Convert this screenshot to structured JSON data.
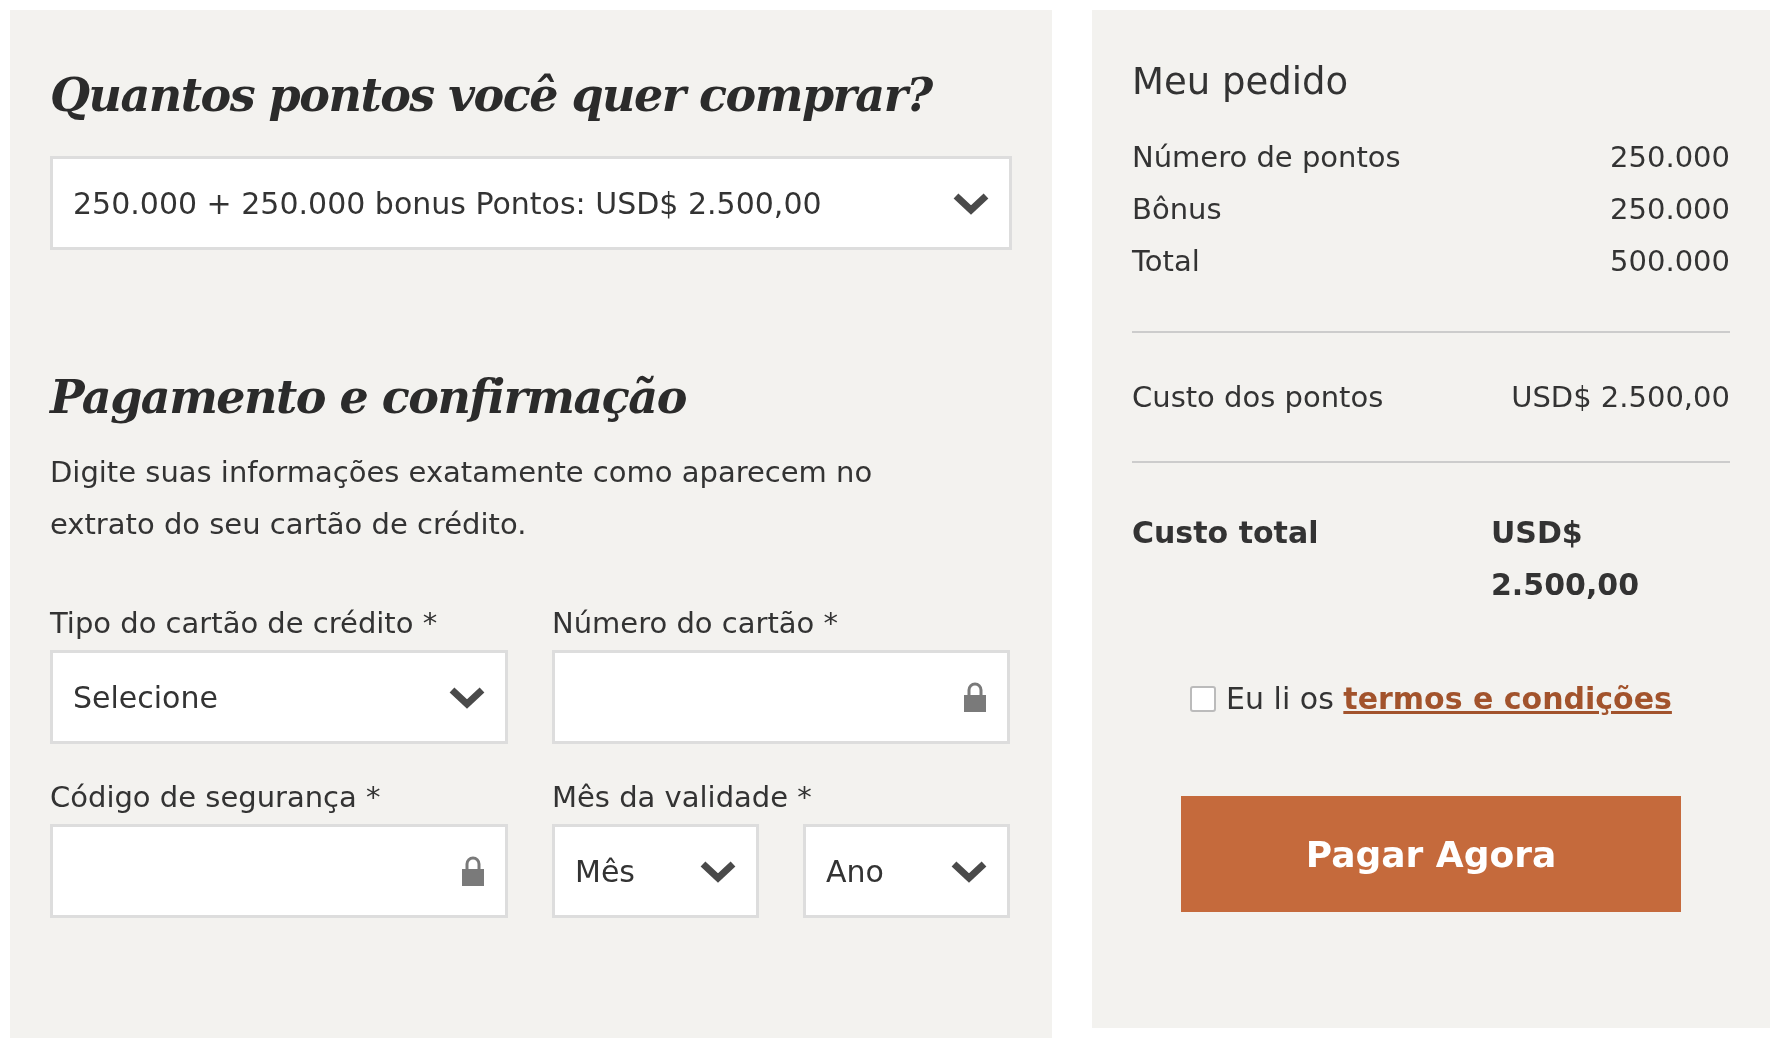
{
  "points_section": {
    "heading": "Quantos pontos você quer comprar?",
    "package_select": {
      "value": "250.000 + 250.000 bonus Pontos: USD$ 2.500,00"
    }
  },
  "payment_section": {
    "heading": "Pagamento e confirmação",
    "instructions": "Digite suas informações exatamente como aparecem no extrato do seu cartão de crédito.",
    "fields": [
      {
        "label": "Tipo do cartão de crédito *",
        "controls": [
          {
            "kind": "select",
            "value": "Selecione"
          }
        ]
      },
      {
        "label": "Número do cartão *",
        "controls": [
          {
            "kind": "secure"
          }
        ]
      },
      {
        "label": "Código de segurança *",
        "controls": [
          {
            "kind": "secure"
          }
        ]
      },
      {
        "label": "Mês da validade *",
        "controls": [
          {
            "kind": "select",
            "value": "Mês"
          },
          {
            "kind": "select",
            "value": "Ano"
          }
        ]
      }
    ]
  },
  "order_summary": {
    "title": "Meu pedido",
    "rows": [
      {
        "label": "Número de pontos",
        "value": "250.000"
      },
      {
        "label": "Bônus",
        "value": "250.000"
      },
      {
        "label": "Total",
        "value": "500.000"
      }
    ],
    "cost": {
      "label": "Custo dos pontos",
      "value": "USD$ 2.500,00"
    },
    "total": {
      "label": "Custo total",
      "value": "USD$ 2.500,00"
    },
    "terms": {
      "checked": false,
      "text": "Eu li os",
      "link": "termos e condições"
    },
    "pay_button": "Pagar Agora"
  }
}
